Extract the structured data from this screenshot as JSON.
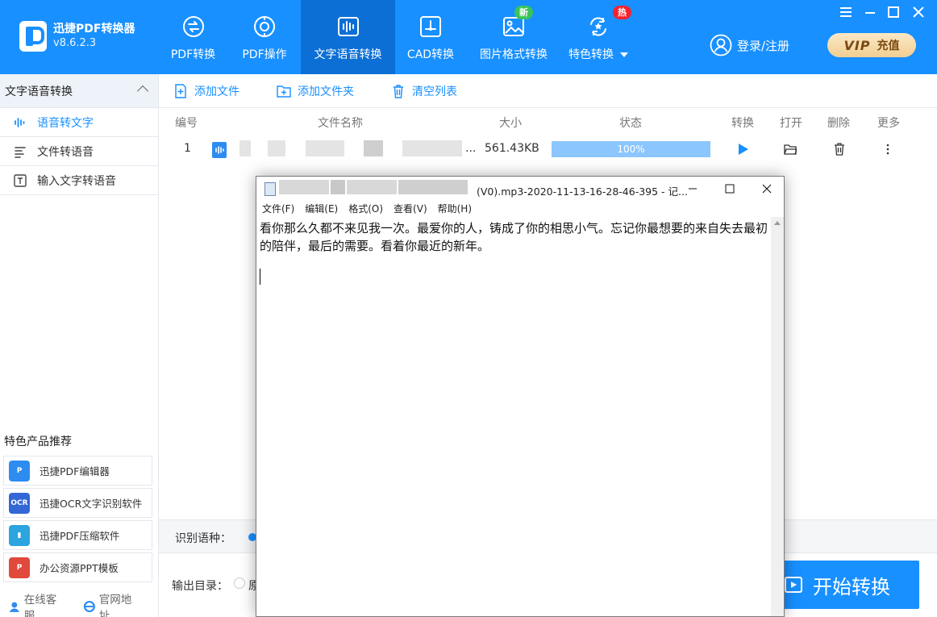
{
  "app": {
    "name": "迅捷PDF转换器",
    "version": "v8.6.2.3"
  },
  "nav": [
    {
      "label": "PDF转换",
      "icon": "pdf-convert-icon"
    },
    {
      "label": "PDF操作",
      "icon": "pdf-operate-icon"
    },
    {
      "label": "文字语音转换",
      "icon": "voice-text-icon",
      "active": true
    },
    {
      "label": "CAD转换",
      "icon": "cad-icon"
    },
    {
      "label": "图片格式转换",
      "icon": "image-icon",
      "badge": "新"
    },
    {
      "label": "特色转换",
      "icon": "special-icon",
      "badge": "热"
    }
  ],
  "account": {
    "login_label": "登录/注册",
    "vip_label": "VIP",
    "recharge_label": "充值"
  },
  "sidebar": {
    "header": "文字语音转换",
    "items": [
      {
        "label": "语音转文字",
        "icon": "voice-wave-icon",
        "active": true
      },
      {
        "label": "文件转语音",
        "icon": "file-lines-icon"
      },
      {
        "label": "输入文字转语音",
        "icon": "text-box-icon"
      }
    ],
    "rec_title": "特色产品推荐",
    "recommendations": [
      {
        "label": "迅捷PDF编辑器",
        "icon": "pdf-editor-icon"
      },
      {
        "label": "迅捷OCR文字识别软件",
        "icon": "ocr-icon"
      },
      {
        "label": "迅捷PDF压缩软件",
        "icon": "pdf-compress-icon"
      },
      {
        "label": "办公资源PPT模板",
        "icon": "ppt-template-icon"
      }
    ],
    "footer": {
      "service": "在线客服",
      "website": "官网地址"
    }
  },
  "toolbar": {
    "add_file": "添加文件",
    "add_folder": "添加文件夹",
    "clear_list": "清空列表"
  },
  "table": {
    "headers": {
      "index": "编号",
      "filename": "文件名称",
      "size": "大小",
      "status": "状态",
      "convert": "转换",
      "open": "打开",
      "delete": "删除",
      "more": "更多"
    },
    "rows": [
      {
        "index": "1",
        "filename_suffix": "...",
        "size": "561.43KB",
        "progress": 100,
        "progress_label": "100%"
      }
    ]
  },
  "options": {
    "language_label": "识别语种：",
    "output_label": "输出目录：",
    "output_option_prefix": "原"
  },
  "start_button": "开始转换",
  "notepad": {
    "title_suffix": "(V0).mp3-2020-11-13-16-28-46-395 - 记...",
    "menu": [
      "文件(F)",
      "编辑(E)",
      "格式(O)",
      "查看(V)",
      "帮助(H)"
    ],
    "content": "看你那么久都不来见我一次。最爱你的人，铸成了你的相思小气。忘记你最想要的来自失去最初的陪伴，最后的需要。看着你最近的新年。"
  }
}
